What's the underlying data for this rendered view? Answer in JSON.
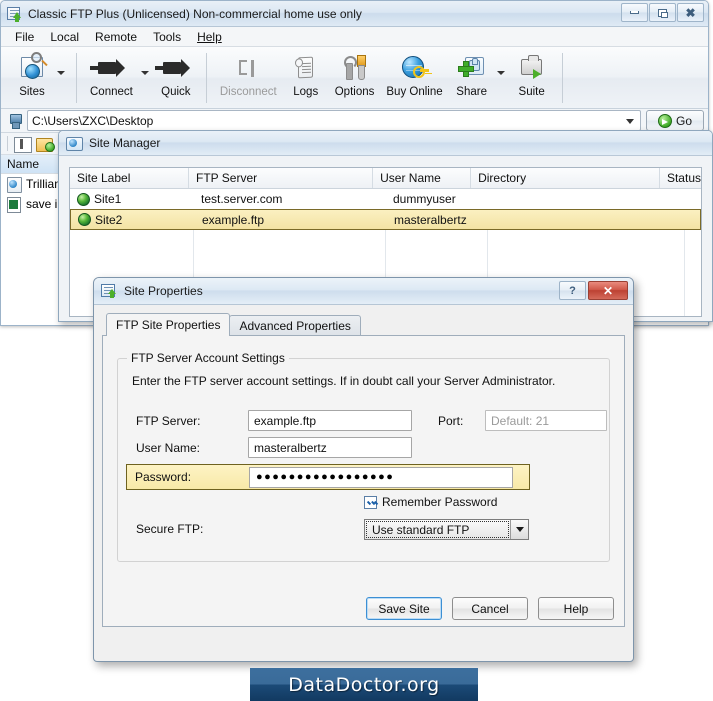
{
  "app": {
    "title": "Classic FTP Plus (Unlicensed) Non-commercial home use only",
    "window_buttons": {
      "minimize": "minimize-icon",
      "maximize": "restore-icon",
      "close": "close-icon"
    }
  },
  "menubar": {
    "items": [
      "File",
      "Local",
      "Remote",
      "Tools",
      "Help"
    ]
  },
  "toolbar": {
    "buttons": [
      {
        "label": "Sites",
        "icon": "sites-globe-icon",
        "has_dropdown": true,
        "disabled": false
      },
      {
        "label": "Connect",
        "icon": "connect-plug-icon",
        "has_dropdown": true,
        "disabled": false
      },
      {
        "label": "Quick",
        "icon": "quick-plug-icon",
        "has_dropdown": false,
        "disabled": false
      },
      {
        "label": "Disconnect",
        "icon": "disconnect-icon",
        "has_dropdown": false,
        "disabled": true
      },
      {
        "label": "Logs",
        "icon": "logs-scroll-icon",
        "has_dropdown": false,
        "disabled": false
      },
      {
        "label": "Options",
        "icon": "options-wrench-icon",
        "has_dropdown": false,
        "disabled": false
      },
      {
        "label": "Buy Online",
        "icon": "buy-online-globe-key-icon",
        "has_dropdown": false,
        "disabled": false
      },
      {
        "label": "Share",
        "icon": "share-thumb-icon",
        "has_dropdown": true,
        "disabled": false
      },
      {
        "label": "Suite",
        "icon": "suite-briefcase-icon",
        "has_dropdown": false,
        "disabled": false
      }
    ]
  },
  "address_bar": {
    "icon": "computer-icon",
    "path": "C:\\Users\\ZXC\\Desktop",
    "dropdown_icon": "chevron-down-icon",
    "go_label": "Go",
    "go_icon": "go-arrow-icon"
  },
  "file_pane": {
    "column_header": "Name",
    "rows": [
      {
        "name": "Trillian",
        "icon": "trillian-file-icon"
      },
      {
        "name": "save in",
        "icon": "excel-file-icon"
      }
    ]
  },
  "site_manager": {
    "title": "Site Manager",
    "title_icon": "site-manager-icon",
    "columns": [
      "Site Label",
      "FTP Server",
      "User Name",
      "Directory",
      "Status"
    ],
    "rows": [
      {
        "site_label": "Site1",
        "ftp_server": "test.server.com",
        "user_name": "dummyuser",
        "directory": "",
        "status": "",
        "selected": false,
        "icon": "globe-green-icon"
      },
      {
        "site_label": "Site2",
        "ftp_server": "example.ftp",
        "user_name": "masteralbertz",
        "directory": "",
        "status": "",
        "selected": true,
        "icon": "globe-green-icon"
      }
    ]
  },
  "site_properties": {
    "title": "Site Properties",
    "title_icon": "site-properties-icon",
    "help_button": "?",
    "close_button": "✕",
    "tabs": [
      {
        "label": "FTP Site Properties",
        "active": true
      },
      {
        "label": "Advanced Properties",
        "active": false
      }
    ],
    "group": {
      "legend": "FTP Server Account Settings",
      "description": "Enter the FTP server account settings. If in doubt call your Server Administrator."
    },
    "fields": {
      "ftp_server_label": "FTP Server:",
      "ftp_server_value": "example.ftp",
      "port_label": "Port:",
      "port_placeholder": "Default: 21",
      "port_value": "",
      "user_name_label": "User Name:",
      "user_name_value": "masteralbertz",
      "password_label": "Password:",
      "password_value": "●●●●●●●●●●●●●●●●●",
      "remember_password_label": "Remember Password",
      "remember_password_checked": true,
      "secure_ftp_label": "Secure FTP:",
      "secure_ftp_value": "Use standard FTP"
    },
    "buttons": {
      "save": "Save Site",
      "cancel": "Cancel",
      "help": "Help"
    }
  },
  "watermark": {
    "text": "DataDoctor.org"
  },
  "colors": {
    "selection_yellow": "#f3e3a4",
    "close_red": "#bc4132",
    "accent_blue": "#3c8fd4",
    "watermark_blue": "#1b4a77"
  }
}
